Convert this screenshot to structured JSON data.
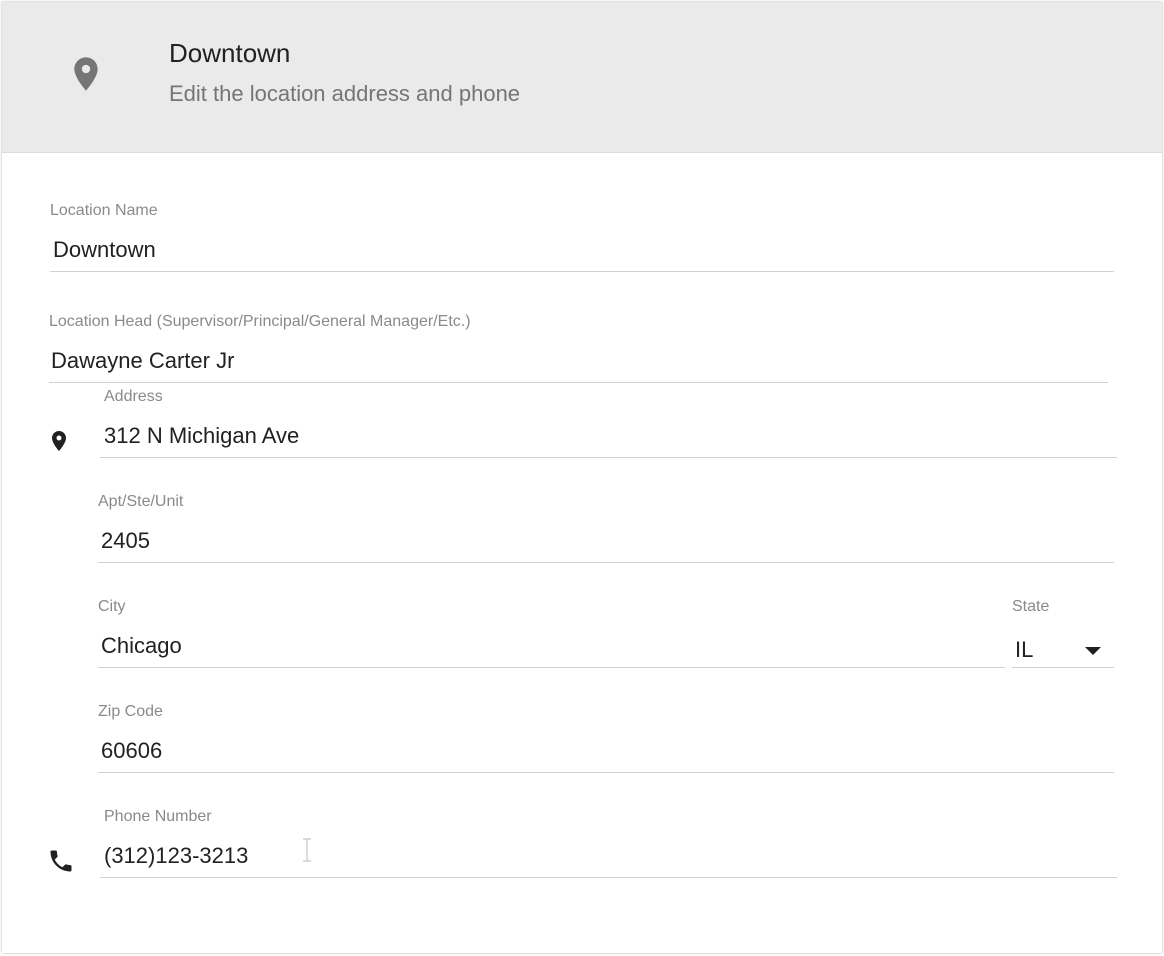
{
  "header": {
    "title": "Downtown",
    "subtitle": "Edit the location address and phone",
    "icon": "location-pin-icon"
  },
  "form": {
    "location_name": {
      "label": "Location Name",
      "value": "Downtown"
    },
    "location_head": {
      "label": "Location Head (Supervisor/Principal/General Manager/Etc.)",
      "value": "Dawayne Carter Jr"
    },
    "address": {
      "label": "Address",
      "value": "312 N Michigan Ave",
      "icon": "location-pin-icon"
    },
    "apt": {
      "label": "Apt/Ste/Unit",
      "value": "2405"
    },
    "city": {
      "label": "City",
      "value": "Chicago"
    },
    "state": {
      "label": "State",
      "value": "IL",
      "icon": "dropdown-arrow-icon"
    },
    "zip": {
      "label": "Zip Code",
      "value": "60606"
    },
    "phone": {
      "label": "Phone Number",
      "value": "(312)123-3213",
      "icon": "phone-icon"
    }
  },
  "colors": {
    "header_bg": "#eaeaea",
    "icon_gray": "#757575",
    "text_primary": "#212121",
    "label_gray": "#8a8a8a",
    "underline": "#d0d0d0"
  }
}
